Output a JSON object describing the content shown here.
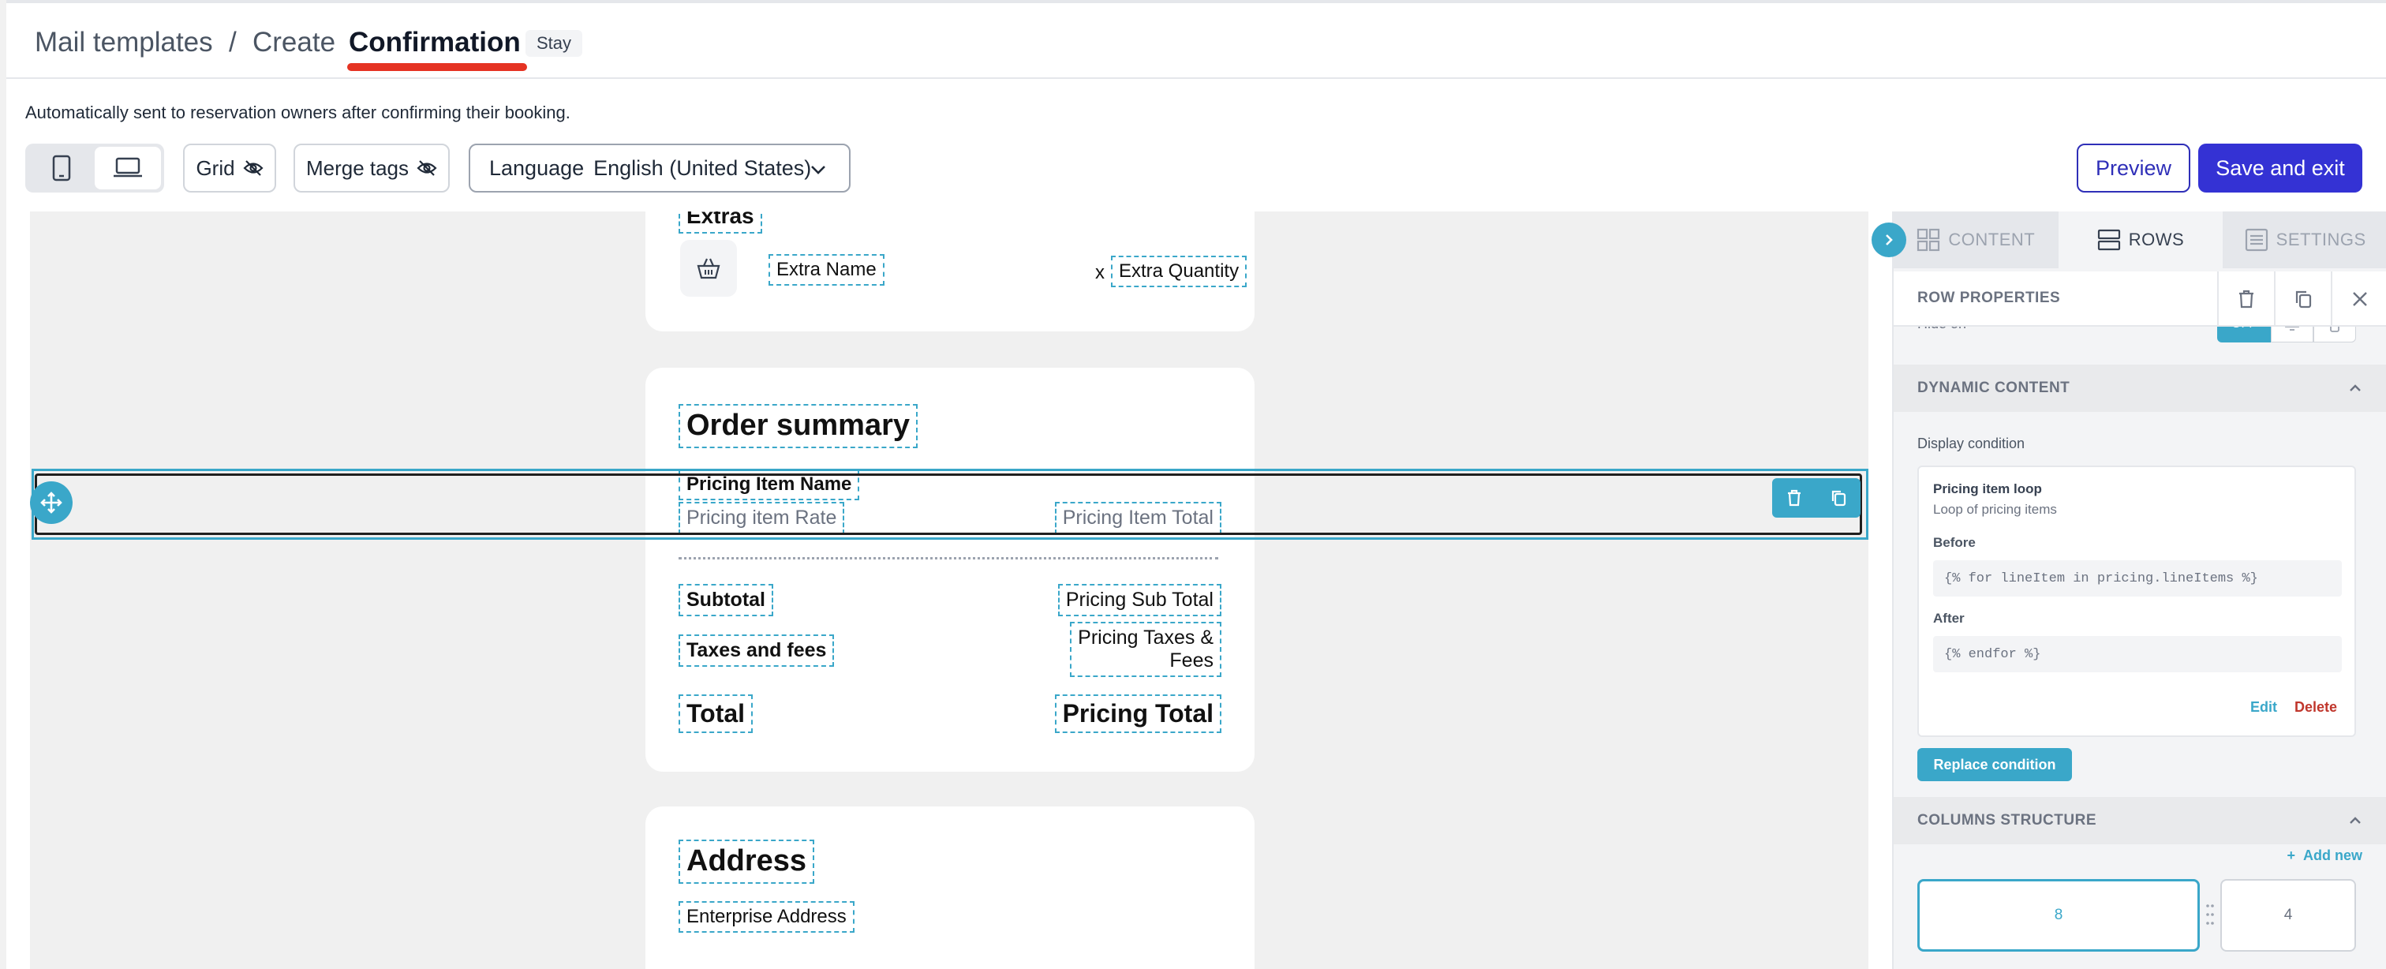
{
  "header": {
    "breadcrumb_root": "Mail templates",
    "breadcrumb_sep": "/",
    "breadcrumb_create": "Create",
    "title": "Confirmation",
    "badge": "Stay"
  },
  "description": "Automatically sent to reservation owners after confirming their booking.",
  "toolbar": {
    "grid_label": "Grid",
    "merge_tags_label": "Merge tags",
    "language_label": "Language",
    "language_value": "English (United States)",
    "preview_label": "Preview",
    "save_label": "Save and exit"
  },
  "canvas": {
    "extras": {
      "heading": "Extras",
      "name": "Extra Name",
      "times": "x",
      "quantity": "Extra Quantity"
    },
    "order_summary": {
      "heading": "Order summary",
      "item_name": "Pricing Item Name",
      "item_rate": "Pricing item Rate",
      "item_total": "Pricing Item Total",
      "subtotal_label": "Subtotal",
      "subtotal_value": "Pricing Sub Total",
      "taxes_label": "Taxes and fees",
      "taxes_value_line1": "Pricing Taxes &",
      "taxes_value_line2": "Fees",
      "total_label": "Total",
      "total_value": "Pricing Total"
    },
    "address": {
      "heading": "Address",
      "value": "Enterprise Address"
    }
  },
  "panel": {
    "tabs": [
      {
        "label": "CONTENT",
        "active": false
      },
      {
        "label": "ROWS",
        "active": true
      },
      {
        "label": "SETTINGS",
        "active": false
      }
    ],
    "row_properties_label": "ROW PROPERTIES",
    "hide_on_label": "Hide on",
    "hide_on_value": "OFF",
    "dynamic_content_label": "DYNAMIC CONTENT",
    "display_condition_label": "Display condition",
    "condition": {
      "title": "Pricing item loop",
      "subtitle": "Loop of pricing items",
      "before_label": "Before",
      "before_code": "{% for lineItem in pricing.lineItems %}",
      "after_label": "After",
      "after_code": "{% endfor %}",
      "edit_label": "Edit",
      "delete_label": "Delete"
    },
    "replace_condition_label": "Replace condition",
    "columns_structure_label": "COLUMNS STRUCTURE",
    "add_new_label": "Add new",
    "columns": [
      "8",
      "4"
    ]
  },
  "colors": {
    "accent": "#3aa7c9",
    "primary": "#3432d4",
    "danger": "#e53323"
  }
}
